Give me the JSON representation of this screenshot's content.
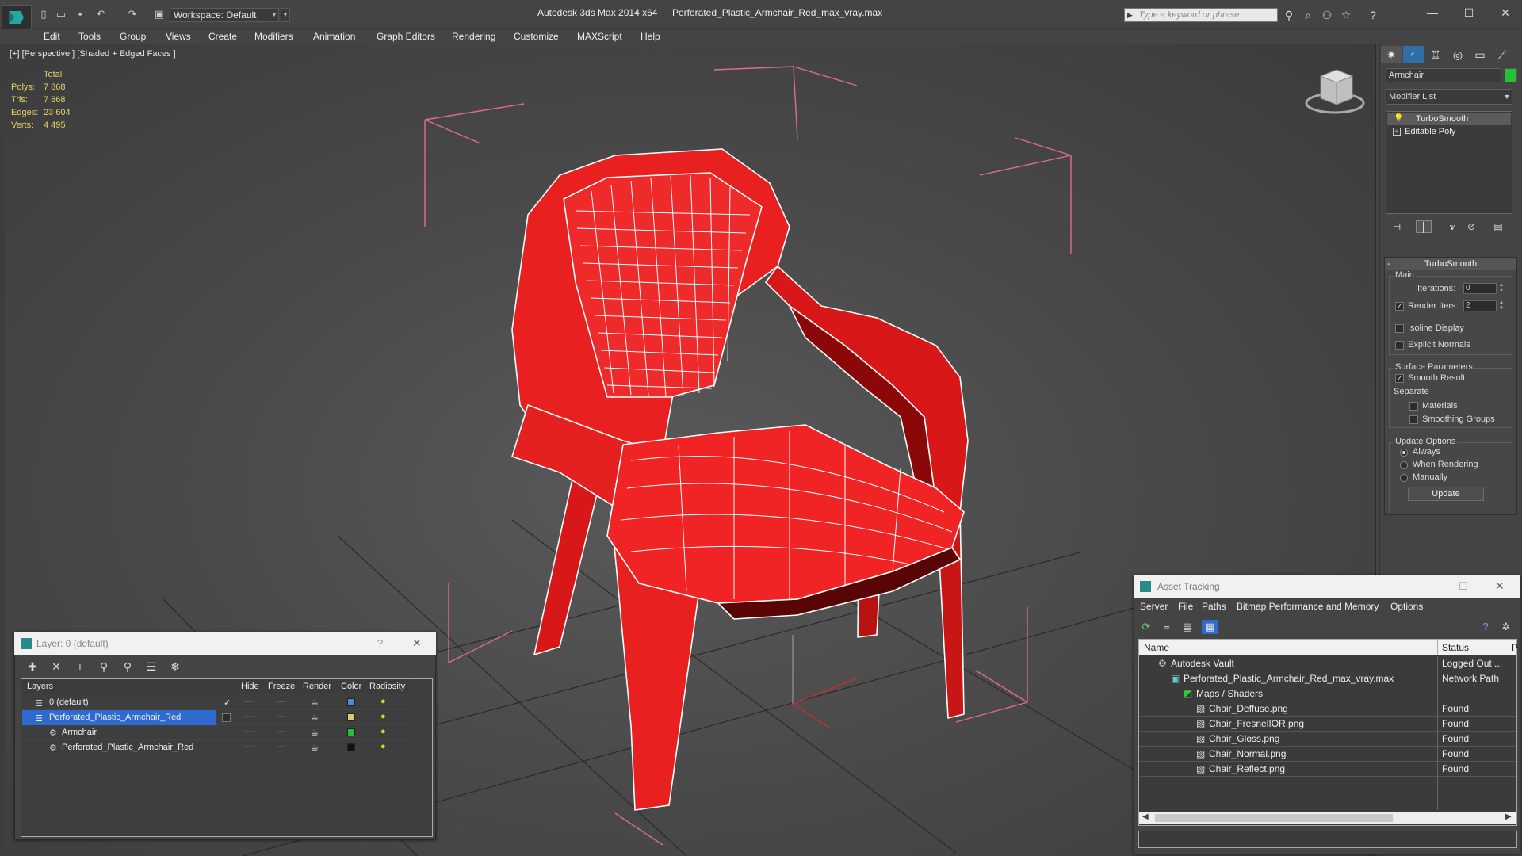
{
  "window": {
    "workspace_label": "Workspace: Default",
    "app_title": "Autodesk 3ds Max  2014 x64",
    "file_title": "Perforated_Plastic_Armchair_Red_max_vray.max",
    "search_placeholder": "Type a keyword or phrase",
    "minimize": "—",
    "maximize": "☐",
    "close": "✕"
  },
  "menu": [
    "Edit",
    "Tools",
    "Group",
    "Views",
    "Create",
    "Modifiers",
    "Animation",
    "Graph Editors",
    "Rendering",
    "Customize",
    "MAXScript",
    "Help"
  ],
  "viewport": {
    "label": "[+] [Perspective ] [Shaded + Edged Faces ]",
    "stats": {
      "total_label": "Total",
      "rows": [
        {
          "label": "Polys:",
          "value": "7 868"
        },
        {
          "label": "Tris:",
          "value": "7 868"
        },
        {
          "label": "Edges:",
          "value": "23 604"
        },
        {
          "label": "Verts:",
          "value": "4 495"
        }
      ]
    }
  },
  "command_panel": {
    "object_name": "Armchair",
    "object_color": "#27c03a",
    "modifier_list": "Modifier List",
    "stack": [
      "TurboSmooth",
      "Editable Poly"
    ],
    "rollout_title": "TurboSmooth",
    "main_group": "Main",
    "iterations_label": "Iterations:",
    "iterations_value": "0",
    "render_iters_label": "Render Iters:",
    "render_iters_value": "2",
    "isoline_label": "Isoline Display",
    "explicit_normals_label": "Explicit Normals",
    "surface_group": "Surface Parameters",
    "smooth_result_label": "Smooth Result",
    "separate_label": "Separate",
    "materials_label": "Materials",
    "smoothing_groups_label": "Smoothing Groups",
    "update_group": "Update Options",
    "always_label": "Always",
    "when_rendering_label": "When Rendering",
    "manually_label": "Manually",
    "update_button": "Update"
  },
  "layer_dialog": {
    "title": "Layer: 0 (default)",
    "help": "?",
    "close": "✕",
    "columns": [
      "Layers",
      "Hide",
      "Freeze",
      "Render",
      "Color",
      "Radiosity"
    ],
    "rows": [
      {
        "name": "0 (default)",
        "color": "#4a8ad8",
        "indent": 1,
        "check": "✓"
      },
      {
        "name": "Perforated_Plastic_Armchair_Red",
        "color": "#d8cc70",
        "indent": 1,
        "check": ""
      },
      {
        "name": "Armchair",
        "color": "#27c03a",
        "indent": 2,
        "check": ""
      },
      {
        "name": "Perforated_Plastic_Armchair_Red",
        "color": "#111111",
        "indent": 2,
        "check": ""
      }
    ],
    "dash": "----"
  },
  "asset_dialog": {
    "title": "Asset Tracking",
    "menu": [
      "Server",
      "File",
      "Paths",
      "Bitmap Performance and Memory",
      "Options"
    ],
    "col_name": "Name",
    "col_status": "Status",
    "col_p": "P",
    "rows": [
      {
        "name": "Autodesk Vault",
        "status": "Logged Out ...",
        "indent": 1
      },
      {
        "name": "Perforated_Plastic_Armchair_Red_max_vray.max",
        "status": "Network Path",
        "indent": 2
      },
      {
        "name": "Maps / Shaders",
        "status": "",
        "indent": 3
      },
      {
        "name": "Chair_Deffuse.png",
        "status": "Found",
        "indent": 4
      },
      {
        "name": "Chair_FresnelIOR.png",
        "status": "Found",
        "indent": 4
      },
      {
        "name": "Chair_Gloss.png",
        "status": "Found",
        "indent": 4
      },
      {
        "name": "Chair_Normal.png",
        "status": "Found",
        "indent": 4
      },
      {
        "name": "Chair_Reflect.png",
        "status": "Found",
        "indent": 4
      }
    ]
  }
}
